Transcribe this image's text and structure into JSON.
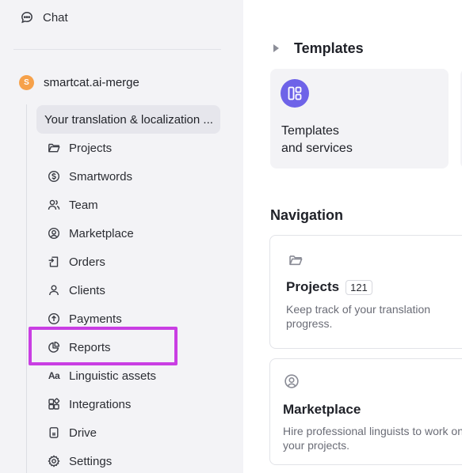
{
  "sidebar": {
    "chat_label": "Chat",
    "workspace": {
      "initial": "S",
      "name": "smartcat.ai-merge"
    },
    "project_item": "Your translation & localization ...",
    "items": [
      {
        "label": "Projects",
        "icon": "folder-icon"
      },
      {
        "label": "Smartwords",
        "icon": "dollar-circle-icon"
      },
      {
        "label": "Team",
        "icon": "team-icon"
      },
      {
        "label": "Marketplace",
        "icon": "marketplace-icon"
      },
      {
        "label": "Orders",
        "icon": "orders-icon"
      },
      {
        "label": "Clients",
        "icon": "user-icon"
      },
      {
        "label": "Payments",
        "icon": "payments-icon"
      },
      {
        "label": "Reports",
        "icon": "pie-chart-icon"
      },
      {
        "label": "Linguistic assets",
        "icon": "aa-icon",
        "glyph": "Aa"
      },
      {
        "label": "Integrations",
        "icon": "integrations-icon"
      },
      {
        "label": "Drive",
        "icon": "drive-icon"
      },
      {
        "label": "Settings",
        "icon": "gear-icon"
      }
    ],
    "highlighted_item": "Reports",
    "highlight_color": "#c93ee3"
  },
  "main": {
    "templates_section": {
      "title": "Templates"
    },
    "templates_card": {
      "title_line1": "Templates",
      "title_line2": "and services",
      "badge_color": "#6e63e8"
    },
    "navigation": {
      "heading": "Navigation",
      "projects": {
        "title": "Projects",
        "count": "121",
        "desc_line1": "Keep track of your translation",
        "desc_line2": "progress."
      },
      "marketplace": {
        "title": "Marketplace",
        "desc_line1": "Hire professional linguists to work on",
        "desc_line2": "your projects."
      }
    }
  }
}
